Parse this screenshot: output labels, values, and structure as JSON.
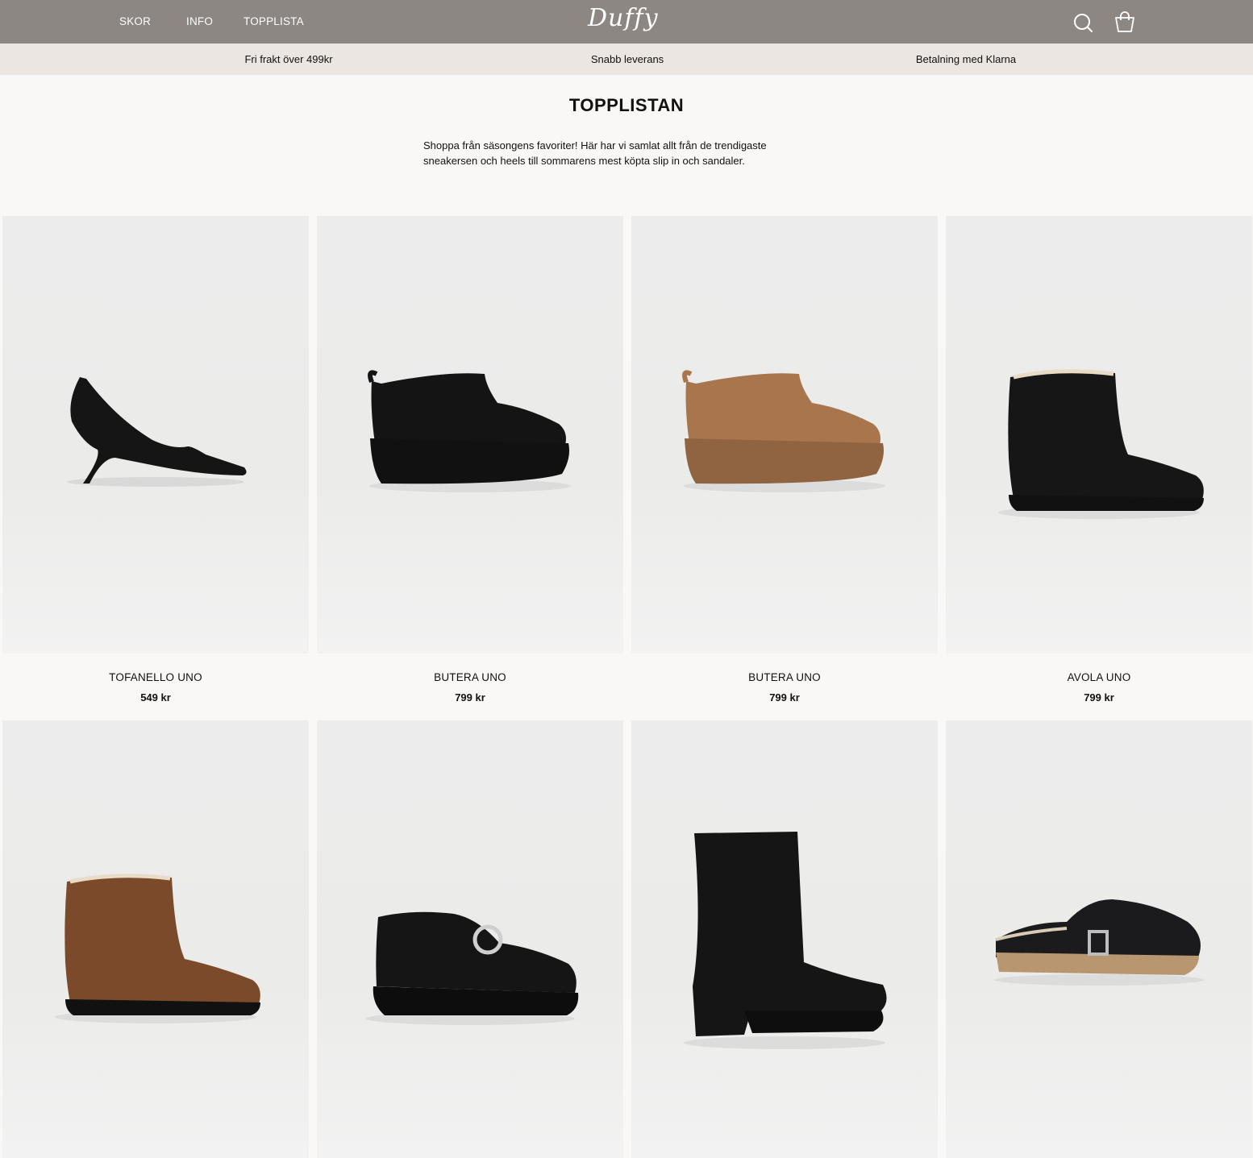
{
  "header": {
    "nav": [
      {
        "label": "SKOR"
      },
      {
        "label": "INFO"
      },
      {
        "label": "TOPPLISTA"
      }
    ],
    "logo_text": "Duffy",
    "icons": [
      "search-icon",
      "shopping-bag-icon"
    ]
  },
  "usp": [
    "Fri frakt över 499kr",
    "Snabb leverans",
    "Betalning med Klarna"
  ],
  "hero": {
    "title": "TOPPLISTAN",
    "description_line1": "Shoppa från säsongens favoriter! Här har vi samlat allt från de trendigaste",
    "description_line2": "sneakersen och heels till sommarens mest köpta slip in och sandaler."
  },
  "products": [
    {
      "name": "TOFANELLO UNO",
      "price": "549 kr",
      "shoe": "pump",
      "color": "#151515"
    },
    {
      "name": "BUTERA UNO",
      "price": "799 kr",
      "shoe": "platform-boot",
      "color": "#141414"
    },
    {
      "name": "BUTERA UNO",
      "price": "799 kr",
      "shoe": "platform-boot",
      "color": "#a9754c"
    },
    {
      "name": "AVOLA UNO",
      "price": "799 kr",
      "shoe": "ankle-boot",
      "color": "#161616"
    },
    {
      "name": "",
      "price": "",
      "shoe": "ankle-boot",
      "color": "#7a4a2a"
    },
    {
      "name": "",
      "price": "",
      "shoe": "loafer",
      "color": "#151515"
    },
    {
      "name": "",
      "price": "",
      "shoe": "heeled-boot",
      "color": "#151515"
    },
    {
      "name": "",
      "price": "",
      "shoe": "clog",
      "color": "#1b1b1d"
    }
  ]
}
